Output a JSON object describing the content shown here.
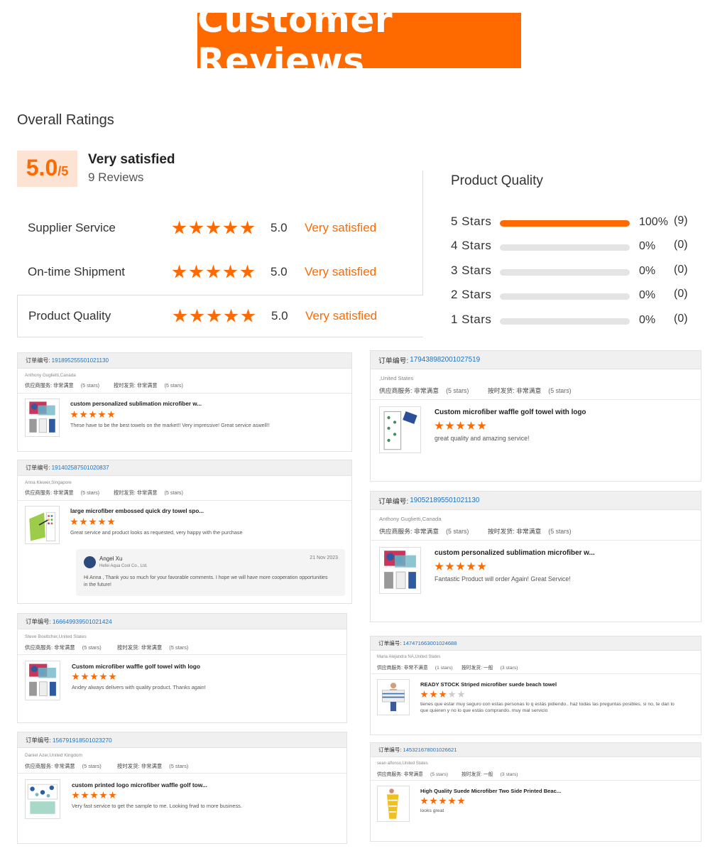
{
  "banner": {
    "title": "Customer Reviews"
  },
  "overall": {
    "title": "Overall Ratings",
    "score": "5.0",
    "score_max": "/5",
    "label": "Very satisfied",
    "count": "9 Reviews",
    "accent_color": "#ff6a00"
  },
  "ratings": [
    {
      "label": "Supplier Service",
      "stars": 5,
      "value": "5.0",
      "text": "Very satisfied"
    },
    {
      "label": "On-time Shipment",
      "stars": 5,
      "value": "5.0",
      "text": "Very satisfied"
    },
    {
      "label": "Product Quality",
      "stars": 5,
      "value": "5.0",
      "text": "Very satisfied"
    }
  ],
  "product_quality": {
    "title": "Product Quality",
    "rows": [
      {
        "label": "5 Stars",
        "fraction": 1.0,
        "pct": "100%",
        "count": "(9)"
      },
      {
        "label": "4 Stars",
        "fraction": 0,
        "pct": "0%",
        "count": "(0)"
      },
      {
        "label": "3 Stars",
        "fraction": 0,
        "pct": "0%",
        "count": "(0)"
      },
      {
        "label": "2 Stars",
        "fraction": 0,
        "pct": "0%",
        "count": "(0)"
      },
      {
        "label": "1 Stars",
        "fraction": 0,
        "pct": "0%",
        "count": "(0)"
      }
    ]
  },
  "order_label": "订单编号:",
  "service_label": "供应商服务:",
  "shipment_label": "按时发货:",
  "reviews": [
    {
      "order_no": "191895255501021130",
      "buyer": "Anthony Guglietti,Canada",
      "service": "非常满意",
      "service_stars": "(5 stars)",
      "shipment": "非常满意",
      "shipment_stars": "(5 stars)",
      "product": "custom personalized sublimation microfiber w...",
      "stars": 5,
      "text": "These have to be the best towels on the market!! Very impressive! Great service aswell!!"
    },
    {
      "order_no": "191402587501020837",
      "buyer": "Anna Klewer,Singapore",
      "service": "非常满意",
      "service_stars": "(5 stars)",
      "shipment": "非常满意",
      "shipment_stars": "(5 stars)",
      "product": "large microfiber embossed quick dry towel spo...",
      "stars": 5,
      "text": "Great service and product looks as requested, very happy with the purchase",
      "reply": {
        "name": "Angel Xu",
        "company": "Hefei Aqua Cool Co., Ltd.",
        "date": "21 Nov 2023",
        "message": "Hi Anna , Thank you so much  for your favorable comments. I hope we will have more cooperation opportunities in the future!"
      }
    },
    {
      "order_no": "166649939501021424",
      "buyer": "Steve Boettcher,United States",
      "service": "非常满意",
      "service_stars": "(5 stars)",
      "shipment": "非常满意",
      "shipment_stars": "(5 stars)",
      "product": "Custom microfiber waffle golf towel with logo",
      "stars": 5,
      "text": "Andey always delivers with quality product. Thanks again!"
    },
    {
      "order_no": "156791918501023270",
      "buyer": "Daniel Azer,United Kingdom",
      "service": "非常满意",
      "service_stars": "(5 stars)",
      "shipment": "非常满意",
      "shipment_stars": "(5 stars)",
      "product": "custom printed logo microfiber waffle golf tow...",
      "stars": 5,
      "text": "Very fast service to get the sample to me. Looking frwd to more business."
    },
    {
      "order_no": "179438982001027519",
      "buyer": ",United States",
      "service": "非常满意",
      "service_stars": "(5 stars)",
      "shipment": "非常满意",
      "shipment_stars": "(5 stars)",
      "product": "Custom microfiber waffle golf towel with logo",
      "stars": 5,
      "text": "great quality and amazing service!"
    },
    {
      "order_no": "190521895501021130",
      "buyer": "Anthony Guglietti,Canada",
      "service": "非常满意",
      "service_stars": "(5 stars)",
      "shipment": "非常满意",
      "shipment_stars": "(5 stars)",
      "product": "custom personalized sublimation microfiber w...",
      "stars": 5,
      "text": "Fantastic Product will order Again! Great Service!"
    },
    {
      "order_no": "147471663001024688",
      "buyer": "Maria Alejandra NA,United States",
      "service": "非常不满意",
      "service_stars": "(1 stars)",
      "shipment": "一般",
      "shipment_stars": "(3 stars)",
      "product": "READY STOCK Striped microfiber suede beach towel",
      "stars": 3,
      "text": "tienes que estar muy seguro con estas personas lo q estás pidiendo.. haz todas las preguntas posibles, si no, te dan lo que quieren y no lo que estás comprando. muy mal servicio"
    },
    {
      "order_no": "145321678001026621",
      "buyer": "sean alfonso,United States",
      "service": "非常满意",
      "service_stars": "(5 stars)",
      "shipment": "一般",
      "shipment_stars": "(3 stars)",
      "product": "High Quality Suede Microfiber Two Side Printed Beac...",
      "stars": 5,
      "text": "looks great"
    }
  ]
}
